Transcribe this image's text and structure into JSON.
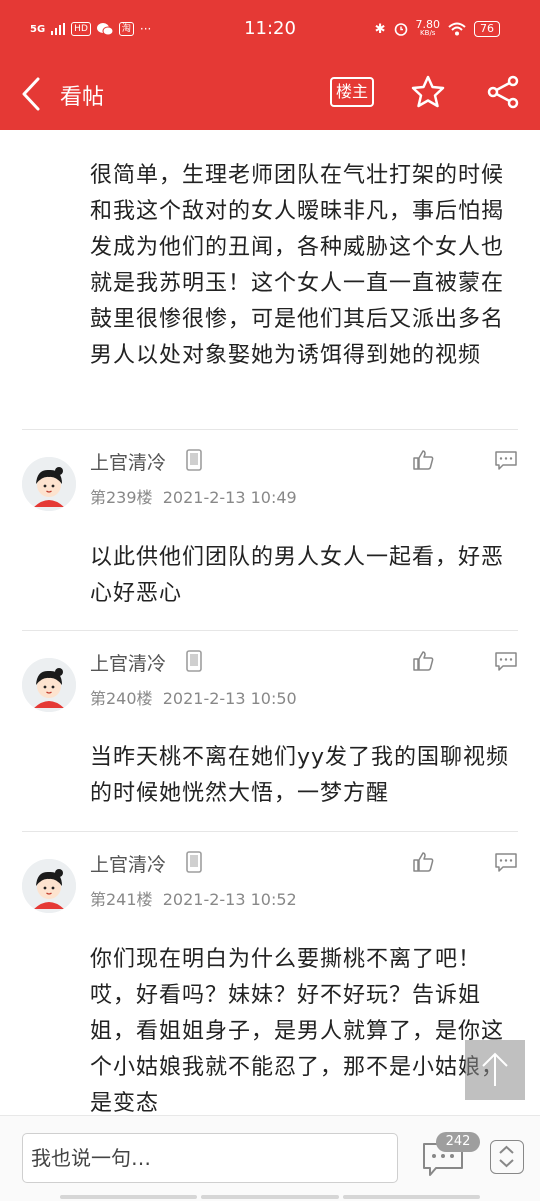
{
  "status_bar": {
    "network": "5G",
    "time": "11:20",
    "speed_value": "7.80",
    "speed_unit": "KB/s",
    "battery": "76"
  },
  "header": {
    "back_label": "<",
    "title": "看帖",
    "louzhu_label": "楼主",
    "accent_color": "#e53935"
  },
  "post_intro": {
    "text": "很简单，生理老师团队在气壮打架的时候和我这个敌对的女人暧昧非凡，事后怕揭发成为他们的丑闻，各种威胁这个女人也就是我苏明玉！这个女人一直一直被蒙在鼓里很惨很惨，可是他们其后又派出多名男人以处对象娶她为诱饵得到她的视频"
  },
  "replies": [
    {
      "username": "上官清冷",
      "floor": "第239楼",
      "datetime": "2021-2-13 10:49",
      "text": "以此供他们团队的男人女人一起看，好恶心好恶心"
    },
    {
      "username": "上官清冷",
      "floor": "第240楼",
      "datetime": "2021-2-13 10:50",
      "text": "当昨天桃不离在她们yy发了我的国聊视频的时候她恍然大悟，一梦方醒"
    },
    {
      "username": "上官清冷",
      "floor": "第241楼",
      "datetime": "2021-2-13 10:52",
      "text": "你们现在明白为什么要撕桃不离了吧！哎，好看吗？妹妹？好不好玩？告诉姐姐，看姐姐身子，是男人就算了，是你这个小姑娘我就不能忍了，那不是小姑娘，是变态"
    }
  ],
  "bottom_bar": {
    "input_placeholder": "我也说一句…",
    "comment_count": "242"
  },
  "icons": {
    "back": "back-arrow-icon",
    "star": "star-icon",
    "share": "share-icon",
    "device": "phone-icon",
    "like": "thumbs-up-icon",
    "reply": "comment-icon",
    "scroll_top": "arrow-up-icon",
    "page_nav": "up-down-icon"
  }
}
